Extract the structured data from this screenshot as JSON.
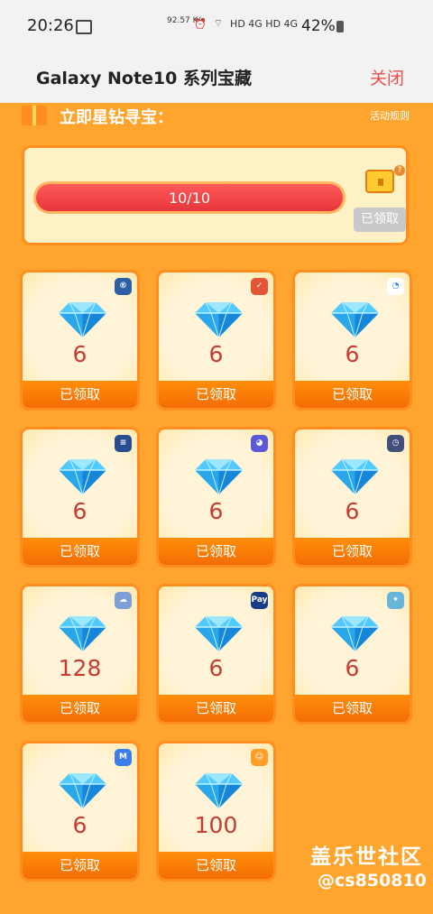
{
  "status": {
    "time": "20:26",
    "speed": "92.57\nK/s",
    "signal_text": "HD 4G HD 4G",
    "battery": "42%"
  },
  "header": {
    "title": "Galaxy Note10 系列宝藏",
    "close": "关闭"
  },
  "treasure": {
    "title": "立即星钻寻宝：",
    "rules": "活动规则",
    "progress_text": "10/10",
    "progress_value": 1.0,
    "claimed_label": "已领取"
  },
  "rewards": [
    {
      "amount": "6",
      "button": "已领取",
      "icon": "samsung-members-icon",
      "icon_color": "#2d5fa7",
      "icon_text": "®"
    },
    {
      "amount": "6",
      "button": "已领取",
      "icon": "check-app-icon",
      "icon_color": "#e35535",
      "icon_text": "✓"
    },
    {
      "amount": "6",
      "button": "已领取",
      "icon": "blue-app-icon",
      "icon_color": "#ffffff",
      "icon_text": "◔"
    },
    {
      "amount": "6",
      "button": "已领取",
      "icon": "news-app-icon",
      "icon_color": "#284d91",
      "icon_text": "≡"
    },
    {
      "amount": "6",
      "button": "已领取",
      "icon": "chat-app-icon",
      "icon_color": "#5b59d8",
      "icon_text": "◕"
    },
    {
      "amount": "6",
      "button": "已领取",
      "icon": "clock-app-icon",
      "icon_color": "#40507a",
      "icon_text": "◷"
    },
    {
      "amount": "128",
      "button": "已领取",
      "icon": "cloud-app-icon",
      "icon_color": "#7c9fd6",
      "icon_text": "☁"
    },
    {
      "amount": "6",
      "button": "已领取",
      "icon": "samsung-pay-icon",
      "icon_color": "#183b85",
      "icon_text": "Pay"
    },
    {
      "amount": "6",
      "button": "已领取",
      "icon": "bixby-icon",
      "icon_color": "#66b6d9",
      "icon_text": "✦"
    },
    {
      "amount": "6",
      "button": "已领取",
      "icon": "m-app-icon",
      "icon_color": "#3b7ee7",
      "icon_text": "M"
    },
    {
      "amount": "100",
      "button": "已领取",
      "icon": "emoji-app-icon",
      "icon_color": "#ff9f28",
      "icon_text": "☺"
    }
  ],
  "watermark": {
    "line1": "盖乐世社区",
    "line2": "@cs850810"
  }
}
